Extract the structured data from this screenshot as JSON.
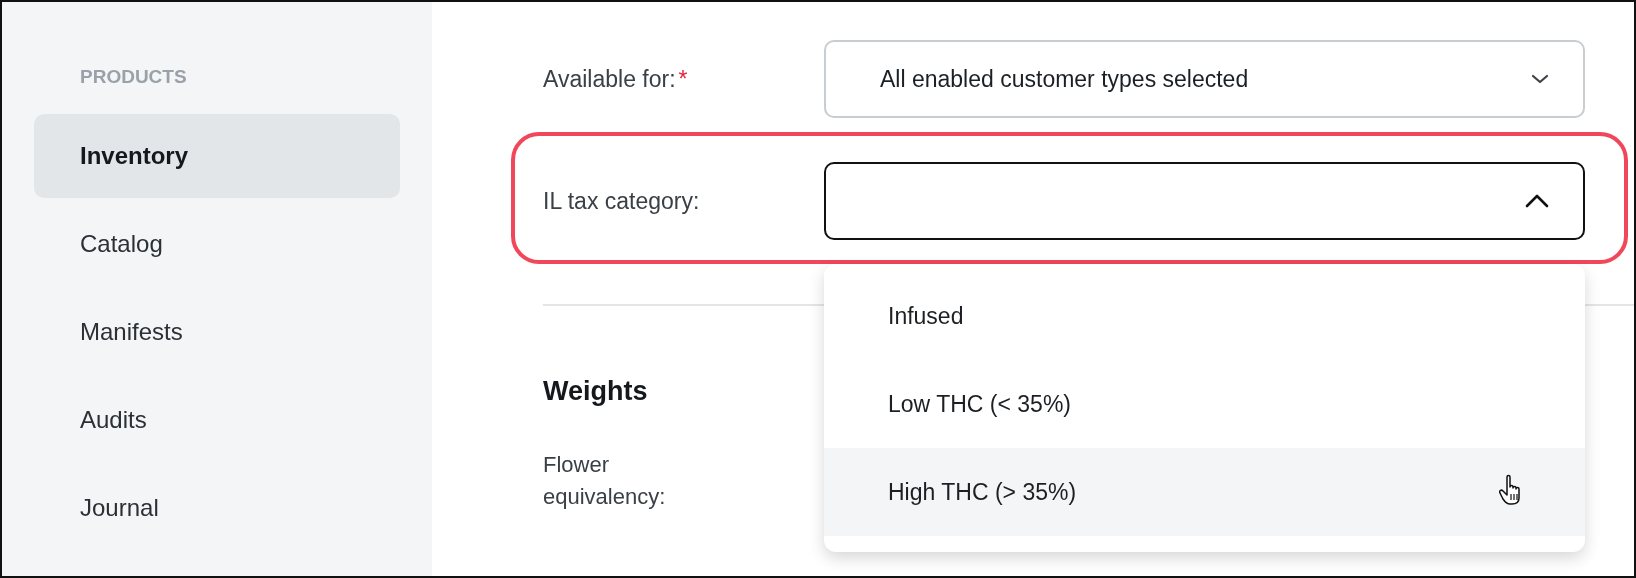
{
  "sidebar": {
    "section": "PRODUCTS",
    "items": [
      {
        "label": "Inventory",
        "selected": true
      },
      {
        "label": "Catalog",
        "selected": false
      },
      {
        "label": "Manifests",
        "selected": false
      },
      {
        "label": "Audits",
        "selected": false
      },
      {
        "label": "Journal",
        "selected": false
      }
    ]
  },
  "form": {
    "fields": [
      {
        "label": "Available for:",
        "required_mark": "*",
        "value": "All enabled customer types selected",
        "expanded": false,
        "outlined": false
      },
      {
        "label": "IL tax category:",
        "expanded": true,
        "outlined": true
      }
    ],
    "section_title": "Weights",
    "weight_label": "Flower equivalency:"
  },
  "dropdown": {
    "options": [
      {
        "label": "Infused",
        "hovered": false
      },
      {
        "label": "Low THC (< 35%)",
        "hovered": false
      },
      {
        "label": "High THC (> 35%)",
        "hovered": true
      }
    ]
  }
}
